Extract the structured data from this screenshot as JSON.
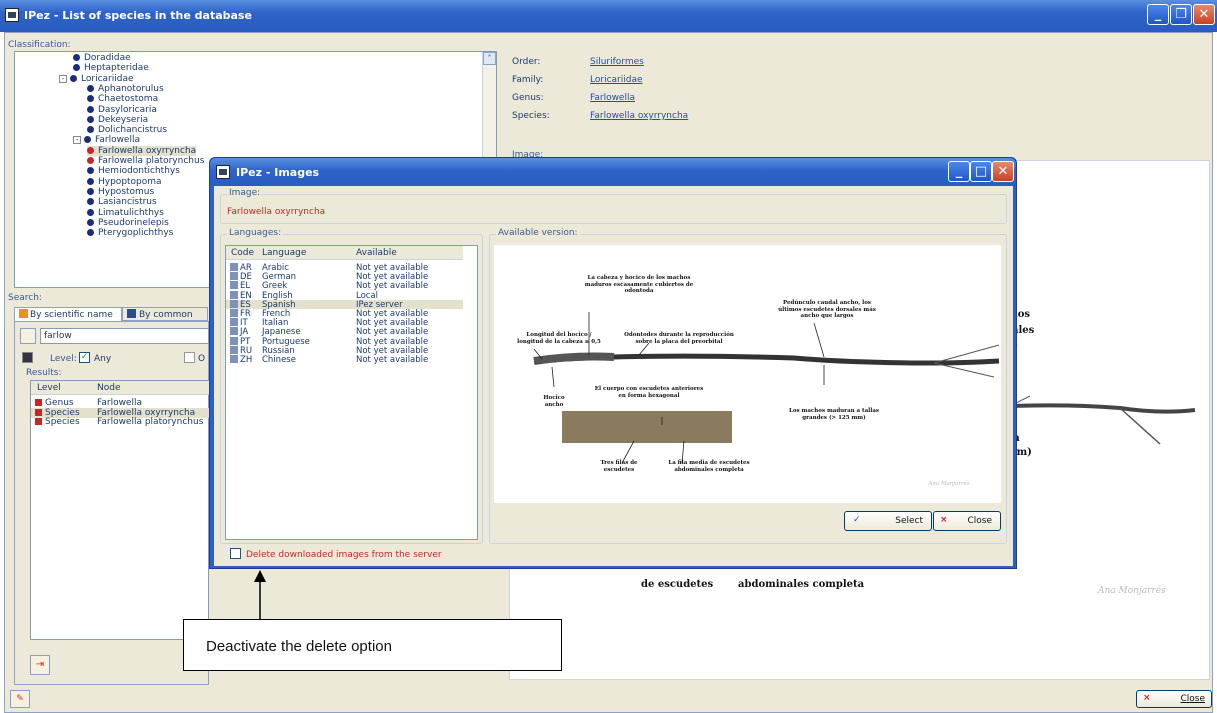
{
  "window": {
    "title": "IPez - List of species in the database"
  },
  "classification": {
    "label": "Classification:",
    "tree": [
      "Doradidae",
      "Heptapteridae",
      "Loricariidae",
      "Aphanotorulus",
      "Chaetostoma",
      "Dasyloricaria",
      "Dekeyseria",
      "Dolichancistrus",
      "Farlowella",
      "Farlowella oxyrryncha",
      "Farlowella platorynchus",
      "Hemiodontichthys",
      "Hypoptopoma",
      "Hypostomus",
      "Lasiancistrus",
      "Limatulichthys",
      "Pseudorinelepis",
      "Pterygoplichthys"
    ]
  },
  "taxonomy": [
    {
      "label": "Order:",
      "value": "Siluriformes"
    },
    {
      "label": "Family:",
      "value": "Loricariidae"
    },
    {
      "label": "Genus:",
      "value": "Farlowella"
    },
    {
      "label": "Species:",
      "value": "Farlowella oxyrryncha"
    }
  ],
  "image_label": "Image:",
  "search": {
    "label": "Search:",
    "tab1": "By scientific name",
    "tab2": "By common nam",
    "query": "farlow",
    "level_label": "Level:",
    "any": "Any",
    "cut": "O"
  },
  "results": {
    "label": "Results:",
    "headers": [
      "Level",
      "Node"
    ],
    "rows": [
      [
        "Genus",
        "Farlowella"
      ],
      [
        "Species",
        "Farlowella oxyrryncha"
      ],
      [
        "Species",
        "Farlowella platorynchus"
      ]
    ]
  },
  "close_label": "Close",
  "bg_image_text": {
    "los": ", los",
    "ales": "ales",
    "s": "s",
    "an": "an",
    "mm": "mm)",
    "escudetes": "de escudetes",
    "abdominales": "abdominales completa",
    "signature": "Ana Monjarrés"
  },
  "dialog": {
    "title": "IPez - Images",
    "image_label": "Image:",
    "image_name": "Farlowella oxyrryncha",
    "languages_label": "Languages:",
    "available_label": "Available version:",
    "headers": [
      "Code",
      "Language",
      "Available"
    ],
    "languages": [
      [
        "AR",
        "Arabic",
        "Not yet available"
      ],
      [
        "DE",
        "German",
        "Not yet available"
      ],
      [
        "EL",
        "Greek",
        "Not yet available"
      ],
      [
        "EN",
        "English",
        "Local"
      ],
      [
        "ES",
        "Spanish",
        "IPez server"
      ],
      [
        "FR",
        "French",
        "Not yet available"
      ],
      [
        "IT",
        "Italian",
        "Not yet available"
      ],
      [
        "JA",
        "Japanese",
        "Not yet available"
      ],
      [
        "PT",
        "Portuguese",
        "Not yet available"
      ],
      [
        "RU",
        "Russian",
        "Not yet available"
      ],
      [
        "ZH",
        "Chinese",
        "Not yet available"
      ]
    ],
    "select": "Select",
    "close": "Close",
    "delete_label": "Delete downloaded images from the server",
    "annotations": {
      "a1": "La cabeza y hocico de los machos maduros escasamente cubiertos de odontoda",
      "a2": "Pedúnculo caudal ancho, los últimos escudetes dorsales más ancho que largos",
      "a3": "Longitud del hocico / longitud de la cabeza ≥ 0,5",
      "a4": "Odontodes durante la reproducción sobre la placa del preorbital",
      "a5": "El cuerpo con escudetes anteriores en forma hexagonal",
      "a6": "Hocico ancho",
      "a7": "Los machos maduran a tallas grandes (> 125 mm)",
      "a8": "Tres filas de escudetes",
      "a9": "La fila media de escudetes abdominales completa",
      "sig": "Ana Monjarrés"
    }
  },
  "callout": "Deactivate the delete option"
}
